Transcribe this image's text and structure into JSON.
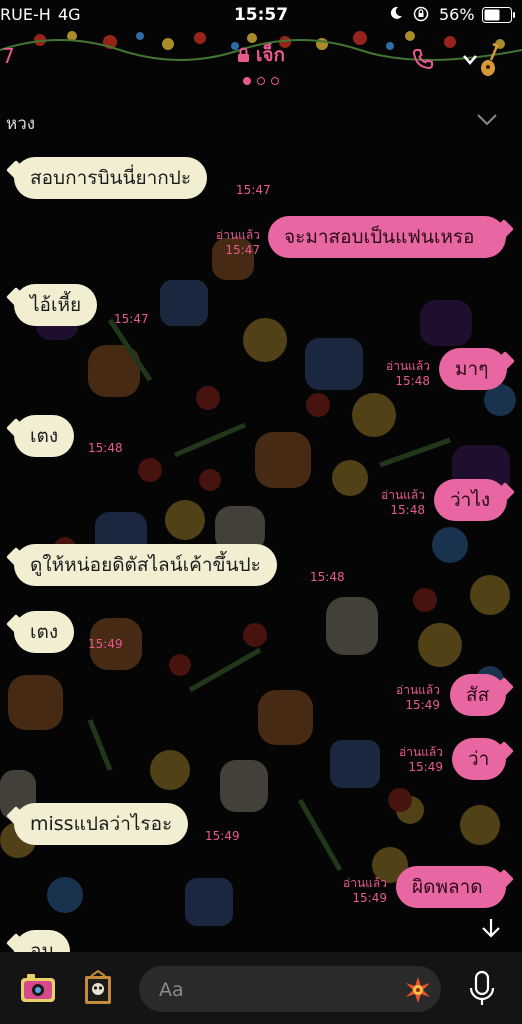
{
  "status_bar": {
    "carrier": "RUE-H",
    "network": "4G",
    "time": "15:57",
    "battery": "56%"
  },
  "header": {
    "back_count": "7",
    "title": "เจ็ก"
  },
  "note": {
    "label": "หวง"
  },
  "messages": [
    {
      "dir": "in",
      "text": "สอบการบินนี่ยากปะ",
      "time": "15:47",
      "read": ""
    },
    {
      "dir": "out",
      "text": "จะมาสอบเป็นแฟนเหรอ",
      "time": "15:47",
      "read": "อ่านแล้ว"
    },
    {
      "dir": "in",
      "text": "ไอ้เหี้ย",
      "time": "15:47",
      "read": ""
    },
    {
      "dir": "out",
      "text": "มาๆ",
      "time": "15:48",
      "read": "อ่านแล้ว"
    },
    {
      "dir": "in",
      "text": "เตง",
      "time": "15:48",
      "read": ""
    },
    {
      "dir": "out",
      "text": "ว่าไง",
      "time": "15:48",
      "read": "อ่านแล้ว"
    },
    {
      "dir": "in",
      "text": "ดูให้หน่อยดิตัสไลน์เค้าขึ้นปะ",
      "time": "15:48",
      "read": ""
    },
    {
      "dir": "in",
      "text": "เตง",
      "time": "15:49",
      "read": ""
    },
    {
      "dir": "out",
      "text": "สัส",
      "time": "15:49",
      "read": "อ่านแล้ว"
    },
    {
      "dir": "out",
      "text": "ว่า",
      "time": "15:49",
      "read": "อ่านแล้ว"
    },
    {
      "dir": "in",
      "text": "missแปลว่าไรอะ",
      "time": "15:49",
      "read": ""
    },
    {
      "dir": "out",
      "text": "ผิดพลาด",
      "time": "15:49",
      "read": "อ่านแล้ว"
    },
    {
      "dir": "in",
      "text": "อม",
      "time": "",
      "read": ""
    }
  ],
  "input": {
    "placeholder": "Aa"
  },
  "colors": {
    "accent": "#e85a8f",
    "incoming_bubble": "#f2eed2",
    "outgoing_bubble": "#e866a2",
    "background": "#050505"
  }
}
